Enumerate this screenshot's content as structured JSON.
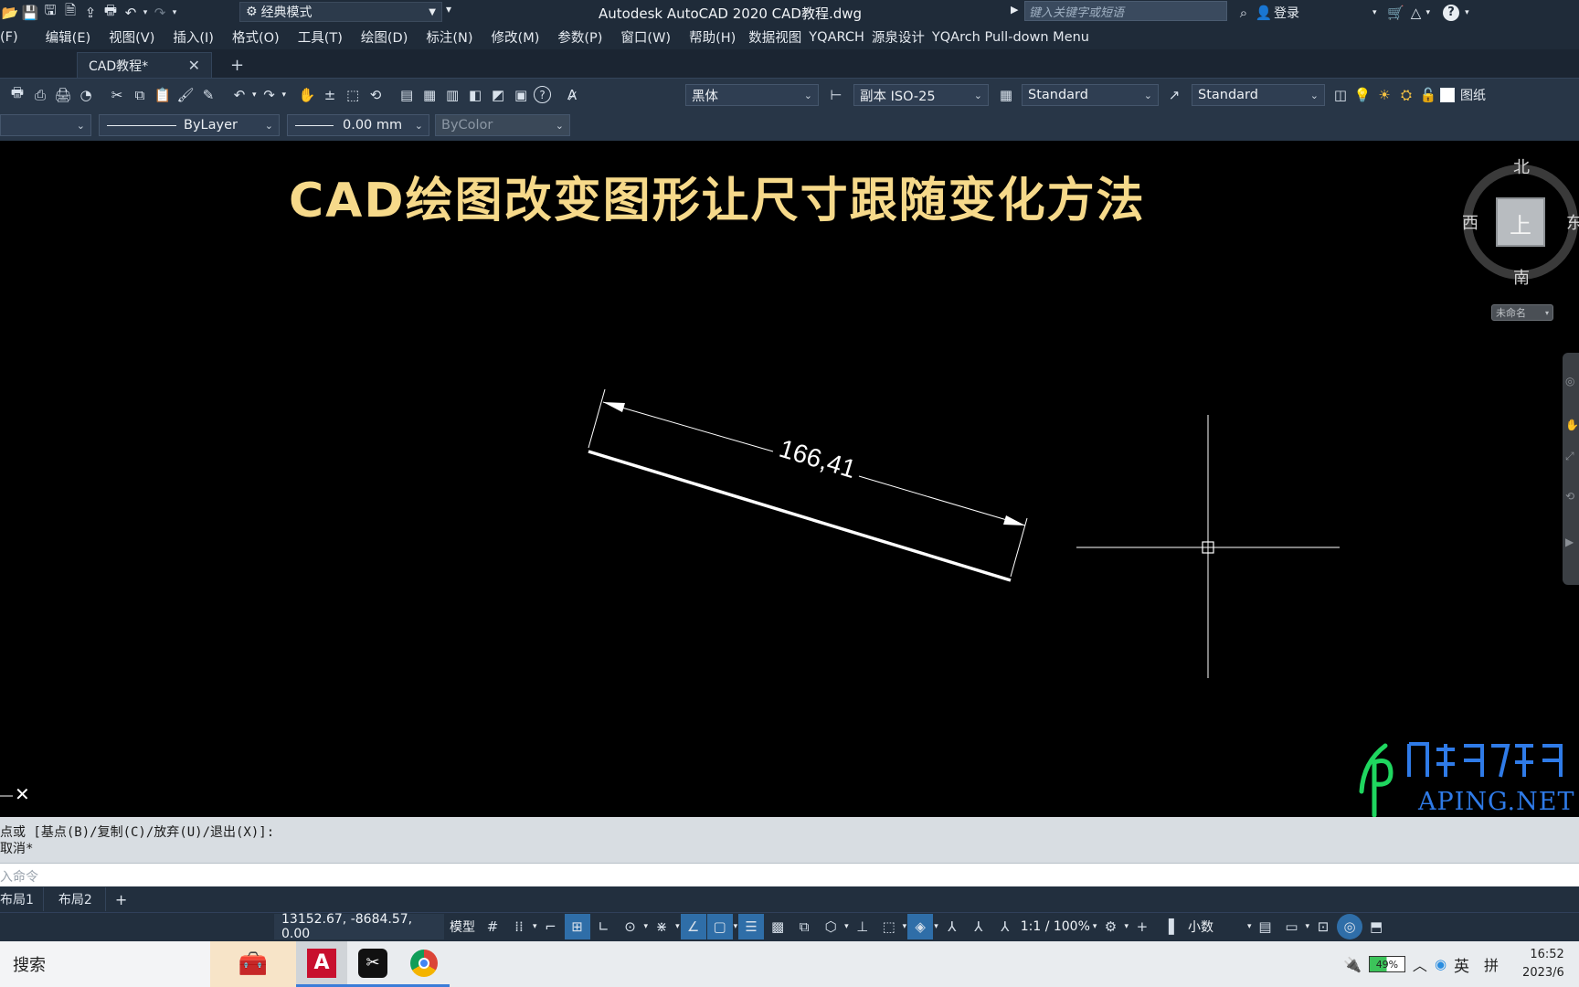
{
  "window": {
    "app_title": "Autodesk AutoCAD 2020    CAD教程.dwg",
    "workspace": "经典模式",
    "search_placeholder": "键入关键字或短语",
    "login_label": "登录"
  },
  "menu": [
    "(F)",
    "编辑(E)",
    "视图(V)",
    "插入(I)",
    "格式(O)",
    "工具(T)",
    "绘图(D)",
    "标注(N)",
    "修改(M)",
    "参数(P)",
    "窗口(W)",
    "帮助(H)",
    "数据视图",
    "YQARCH",
    "源泉设计",
    "YQArch Pull-down Menu"
  ],
  "tabs": {
    "active": "CAD教程*",
    "new_tab": "+"
  },
  "toolbar1": {
    "text_style_font": "黑体",
    "dim_style": "副本 ISO-25",
    "table_style": "Standard",
    "multileader_style": "Standard",
    "paper_label": "图纸"
  },
  "toolbar2": {
    "linetype": "ByLayer",
    "lineweight": "0.00 mm",
    "plot_style": "ByColor"
  },
  "canvas": {
    "title": "CAD绘图改变图形让尺寸跟随变化方法",
    "dimension_text": "166,41",
    "viewcube": {
      "north": "北",
      "south": "南",
      "west": "西",
      "east": "东",
      "top_face": "上",
      "ucs_label": "未命名"
    },
    "watermark_text": "APING.NET"
  },
  "command": {
    "history_line1": "点或 [基点(B)/复制(C)/放弃(U)/退出(X)]:",
    "history_line2": "取消*",
    "input_placeholder": "入命令"
  },
  "layout_tabs": [
    "布局1",
    "布局2",
    "+"
  ],
  "status": {
    "coordinates": "13152.67, -8684.57, 0.00",
    "model_label": "模型",
    "annotation_scale": "1:1 / 100%",
    "units": "小数"
  },
  "taskbar": {
    "search_label": "搜索",
    "battery": "49%",
    "ime_lang": "英",
    "ime_mode": "拼",
    "time": "16:52",
    "date": "2023/6"
  },
  "colors": {
    "title_yellow": "#f6d98a",
    "panel_dark": "#1f2b39",
    "toolbar": "#283647",
    "status_active": "#2f6ea8",
    "watermark_green": "#1fd65f",
    "watermark_blue": "#2f7be8"
  }
}
